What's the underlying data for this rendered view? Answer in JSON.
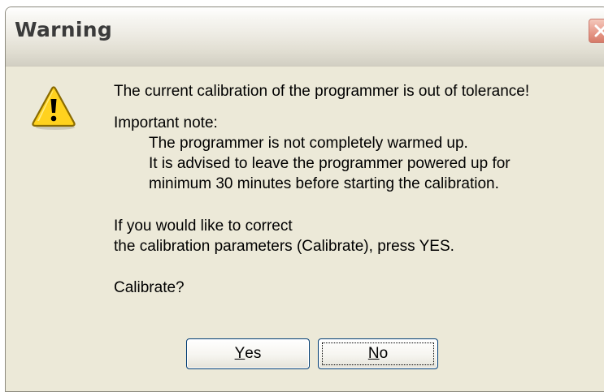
{
  "window": {
    "title": "Warning"
  },
  "icon": "warning-triangle-icon",
  "message": {
    "line1": "The current calibration of the programmer is out of tolerance!",
    "note_heading": "Important note:",
    "note_lines": [
      "The programmer is not completely warmed up.",
      "It is advised to leave the programmer powered up for",
      "minimum 30 minutes before starting the calibration."
    ],
    "instruction_lines": [
      "If you would like to correct",
      "the calibration parameters (Calibrate), press YES."
    ],
    "question": "Calibrate?"
  },
  "buttons": {
    "yes": {
      "mnemonic": "Y",
      "rest": "es"
    },
    "no": {
      "mnemonic": "N",
      "rest": "o"
    }
  },
  "colors": {
    "dialog_bg": "#ece9d8",
    "close_button": "#e08a78",
    "button_border": "#003c74",
    "warning_yellow": "#ffd21e"
  }
}
